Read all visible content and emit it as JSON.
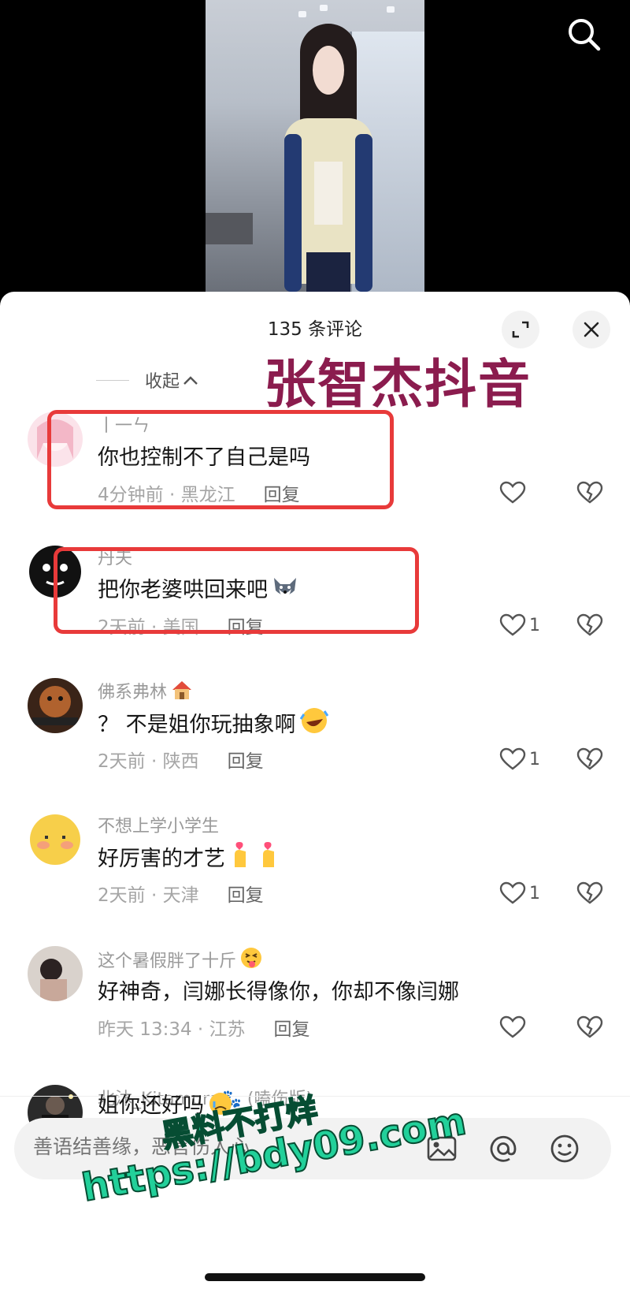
{
  "sheet": {
    "title": "135 条评论",
    "collapse_label": "收起",
    "overlay_caption": "张智杰抖音"
  },
  "comments": [
    {
      "name": "丨一ㄣ",
      "text": "你也控制不了自己是吗",
      "emoji": "",
      "time_location": "4分钟前 · 黑龙江",
      "reply": "回复",
      "likes": ""
    },
    {
      "name": "丹夫",
      "text": "把你老婆哄回来吧",
      "emoji": "wolf-emoji",
      "time_location": "2天前 · 美国",
      "reply": "回复",
      "likes": "1"
    },
    {
      "name": "佛系弗林",
      "name_emoji": "house-emoji",
      "text": "？ 不是姐你玩抽象啊",
      "emoji": "rofl-emoji",
      "time_location": "2天前 · 陕西",
      "reply": "回复",
      "likes": "1"
    },
    {
      "name": "不想上学小学生",
      "text": "好厉害的才艺",
      "emoji": "finger-heart-emoji",
      "time_location": "2天前 · 天津",
      "reply": "回复",
      "likes": "1"
    },
    {
      "name": "这个暑假胖了十斤",
      "name_emoji": "tongue-emoji",
      "text": "好神奇，闫娜长得像你，你却不像闫娜",
      "emoji": "",
      "time_location": "昨天 13:34 · 江苏",
      "reply": "回复",
      "likes": ""
    },
    {
      "name": "北沐_Kitamura🐾 (嗑伤版)",
      "text": "姐你还好吗",
      "emoji": "crying-emoji",
      "time_location": "",
      "reply": "",
      "likes": ""
    }
  ],
  "input": {
    "placeholder": "善语结善缘，恶言伤人心"
  },
  "watermark": {
    "line1": "黑料不打烊",
    "line2": "https://bdy09.com"
  },
  "colors": {
    "highlight_box": "#e83a3a",
    "caption": "#8b1c4e",
    "watermark": "#22d09a"
  }
}
